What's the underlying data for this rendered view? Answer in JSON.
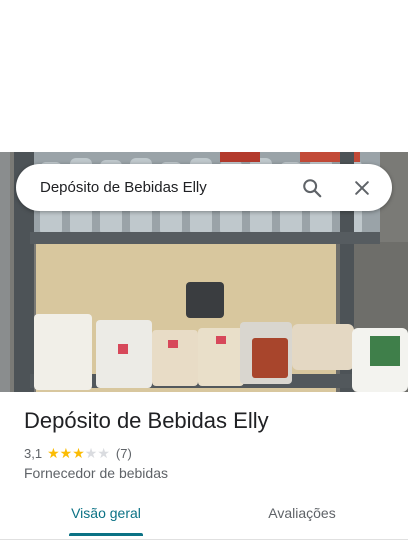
{
  "search": {
    "query": "Depósito de Bebidas Elly",
    "search_icon": "search-icon",
    "close_icon": "close-icon"
  },
  "place": {
    "name": "Depósito de Bebidas Elly",
    "rating": "3,1",
    "rating_stars": 3,
    "rating_max": 5,
    "review_count": "(7)",
    "category": "Fornecedor de bebidas"
  },
  "tabs": [
    {
      "label": "Visão geral",
      "active": true
    },
    {
      "label": "Avaliações",
      "active": false
    }
  ],
  "colors": {
    "accent": "#0b7285",
    "star": "#fbbc04",
    "star_empty": "#dadce0",
    "text_primary": "#202124",
    "text_secondary": "#5f6368"
  }
}
